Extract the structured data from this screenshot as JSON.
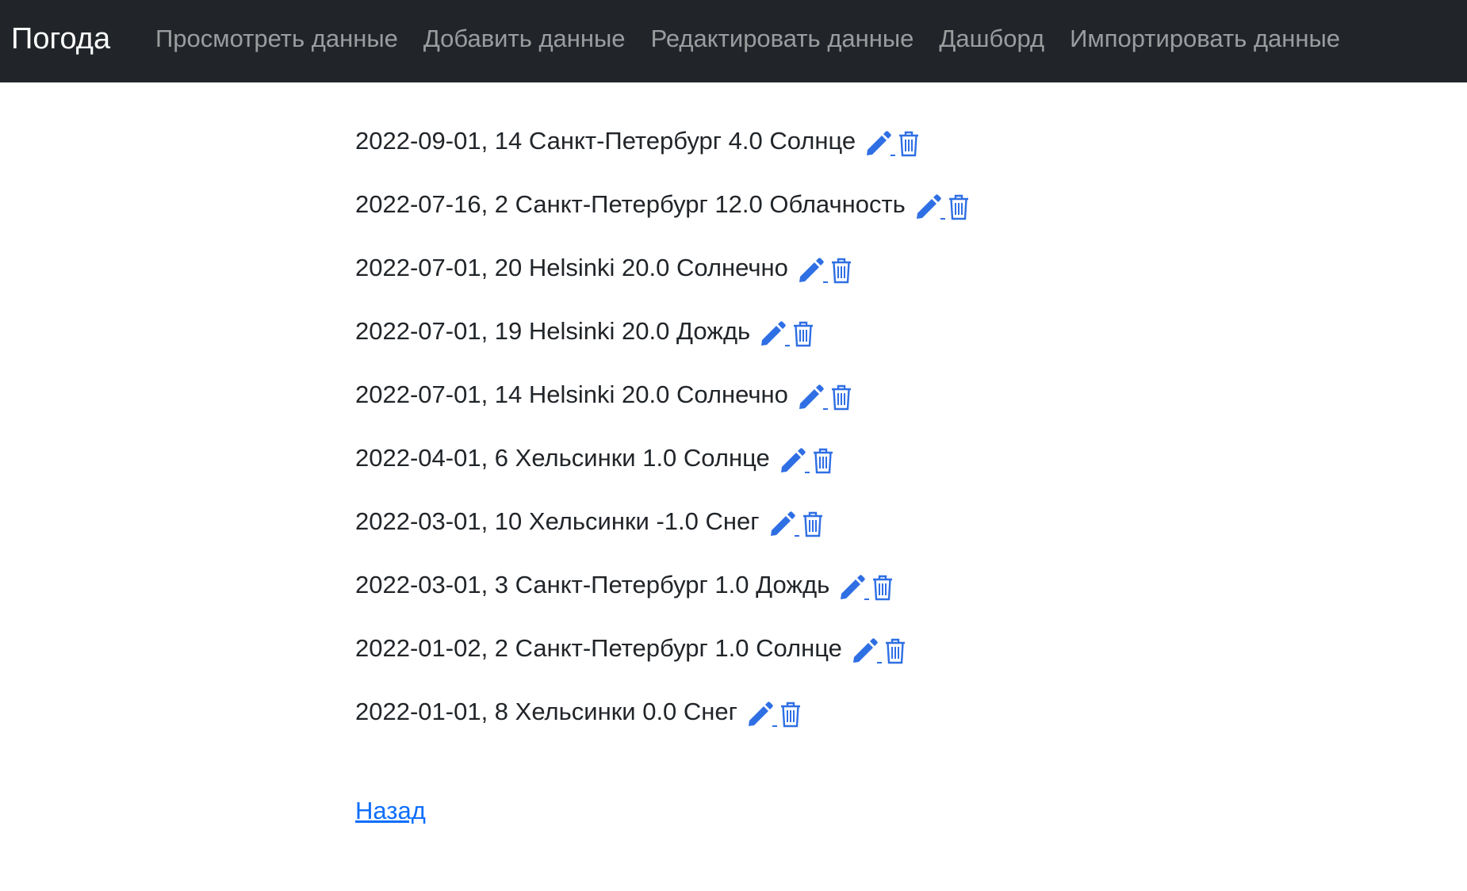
{
  "navbar": {
    "brand": "Погода",
    "links": [
      {
        "label": "Просмотреть данные"
      },
      {
        "label": "Добавить данные"
      },
      {
        "label": "Редактировать данные"
      },
      {
        "label": "Дашборд"
      },
      {
        "label": "Импортировать данные"
      }
    ]
  },
  "records": [
    {
      "text": "2022-09-01, 14 Санкт-Петербург 4.0 Солнце"
    },
    {
      "text": "2022-07-16, 2 Санкт-Петербург 12.0 Облачность"
    },
    {
      "text": "2022-07-01, 20 Helsinki 20.0 Солнечно"
    },
    {
      "text": "2022-07-01, 19 Helsinki 20.0 Дождь"
    },
    {
      "text": "2022-07-01, 14 Helsinki 20.0 Солнечно"
    },
    {
      "text": "2022-04-01, 6 Хельсинки 1.0 Солнце"
    },
    {
      "text": "2022-03-01, 10 Хельсинки -1.0 Снег"
    },
    {
      "text": "2022-03-01, 3 Санкт-Петербург 1.0 Дождь"
    },
    {
      "text": "2022-01-02, 2 Санкт-Петербург 1.0 Солнце"
    },
    {
      "text": "2022-01-01, 8 Хельсинки 0.0 Снег"
    }
  ],
  "icons": {
    "edit": "pencil-icon",
    "delete": "trash-icon"
  },
  "colors": {
    "navbar_bg": "#212529",
    "icon": "#2f6fe4",
    "link": "#0d6efd"
  },
  "back_link": {
    "label": "Назад"
  }
}
